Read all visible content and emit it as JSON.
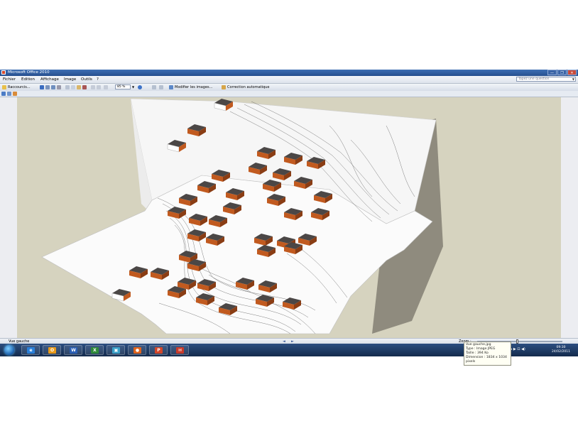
{
  "window": {
    "title": "Microsoft Office 2010",
    "controls": [
      "—",
      "❐",
      "✕"
    ]
  },
  "menu": {
    "items": [
      "Fichier",
      "Edition",
      "Affichage",
      "Image",
      "Outils",
      "?"
    ],
    "help_placeholder": "Tapez une question"
  },
  "toolbar": {
    "shortcuts_label": "Raccourcis...",
    "zoom_value": "85 %",
    "edit_images_label": "Modifier les images...",
    "auto_correct_label": "Correction automatique"
  },
  "tooltip": {
    "lines": [
      "Vue gauche.jpg",
      "Type : Image JPEG",
      "Taille : 394 Ko",
      "Dimension : 1834 x 1034",
      "pixels"
    ]
  },
  "status": {
    "filename": "Vue gauche",
    "nav_prev": "◄",
    "nav_next": "►",
    "zoom_label": "Zoom :",
    "zoom_fraction": 0.47
  },
  "taskbar": {
    "apps": [
      {
        "name": "internet-explorer",
        "glyph": "e",
        "color": "#2a7fd8"
      },
      {
        "name": "outlook",
        "glyph": "O",
        "color": "#e89a1a"
      },
      {
        "name": "word",
        "glyph": "W",
        "color": "#2b5fb4"
      },
      {
        "name": "excel",
        "glyph": "X",
        "color": "#2f8a3a"
      },
      {
        "name": "picture-manager",
        "glyph": "▣",
        "color": "#3aa0c8"
      },
      {
        "name": "firefox",
        "glyph": "●",
        "color": "#e0631c"
      },
      {
        "name": "powerpoint",
        "glyph": "P",
        "color": "#d2462a"
      },
      {
        "name": "image-viewer",
        "glyph": "✉",
        "color": "#c83a2a"
      }
    ],
    "tray_icons": "▲ ◆ ▶ ⊡ ◀)",
    "time": "09:30",
    "date": "24/02/2011"
  },
  "colors": {
    "roof": "#4b4746",
    "wall_orange": "#c15a1f",
    "terrain": "#fbfbfb",
    "background": "#d6d3bf"
  }
}
